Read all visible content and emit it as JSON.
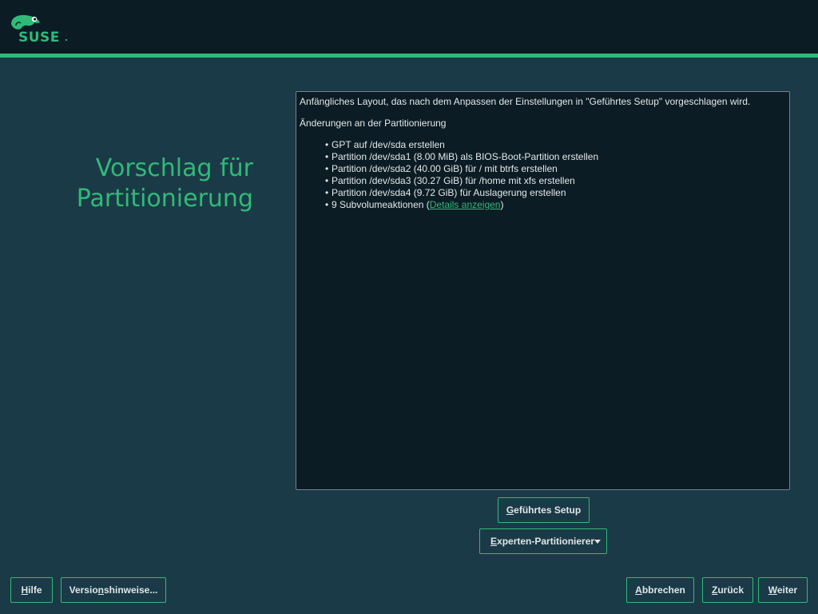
{
  "header": {
    "logo_text": "SUSE"
  },
  "page": {
    "title_line1": "Vorschlag für",
    "title_line2": "Partitionierung"
  },
  "proposal": {
    "intro": "Anfängliches Layout, das nach dem Anpassen der Einstellungen in \"Geführtes Setup\" vorgeschlagen wird.",
    "changes_heading": "Änderungen an der Partitionierung",
    "items": [
      "GPT auf /dev/sda erstellen",
      "Partition /dev/sda1 (8.00 MiB) als BIOS-Boot-Partition erstellen",
      "Partition /dev/sda2 (40.00 GiB) für / mit btrfs erstellen",
      "Partition /dev/sda3 (30.27 GiB) für /home mit xfs erstellen",
      "Partition /dev/sda4 (9.72 GiB) für Auslagerung erstellen"
    ],
    "subvolume_prefix": "9 Subvolumeaktionen (",
    "subvolume_link": "Details anzeigen",
    "subvolume_suffix": ")"
  },
  "buttons": {
    "guided_first": "G",
    "guided_rest": "eführtes Setup",
    "expert_first": "E",
    "expert_rest": "xperten-Partitionierer",
    "help_first": "H",
    "help_rest": "ilfe",
    "release_pre": "Versio",
    "release_key": "n",
    "release_post": "shinweise...",
    "abort_first": "A",
    "abort_rest": "bbrechen",
    "back_first": "Z",
    "back_rest": "urück",
    "next_first": "W",
    "next_rest": "eiter"
  },
  "colors": {
    "accent": "#30ba78",
    "background": "#1b3a47",
    "header": "#0b1c25",
    "panel": "#0c1c24"
  }
}
